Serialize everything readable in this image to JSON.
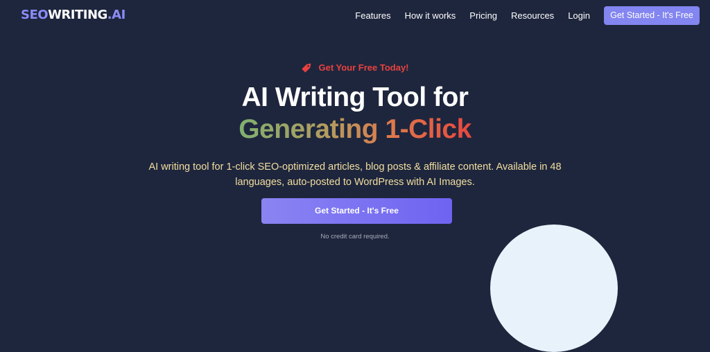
{
  "header": {
    "logo": {
      "seo": "SEO",
      "writing": "WRITING",
      "ai": ".AI"
    },
    "nav": [
      {
        "label": "Features"
      },
      {
        "label": "How it works"
      },
      {
        "label": "Pricing"
      },
      {
        "label": "Resources"
      },
      {
        "label": "Login"
      }
    ],
    "cta_label": "Get Started - It's Free"
  },
  "hero": {
    "promo": "Get Your Free Today!",
    "headline_line1": "AI Writing Tool for",
    "headline_line2": "Generating 1-Click",
    "subtitle_line1": "AI writing tool for 1-click SEO-optimized articles, blog posts & affiliate content. Available in 48",
    "subtitle_line2": "languages, auto-posted to WordPress with AI Images.",
    "cta_label": "Get Started - It's Free",
    "note": "No credit card required."
  },
  "colors": {
    "background": "#1e263d",
    "accent": "#8385f0",
    "promo": "#e8423e",
    "subtitle": "#f3dfa1"
  },
  "icons": {
    "promo": "price-tag-icon"
  }
}
